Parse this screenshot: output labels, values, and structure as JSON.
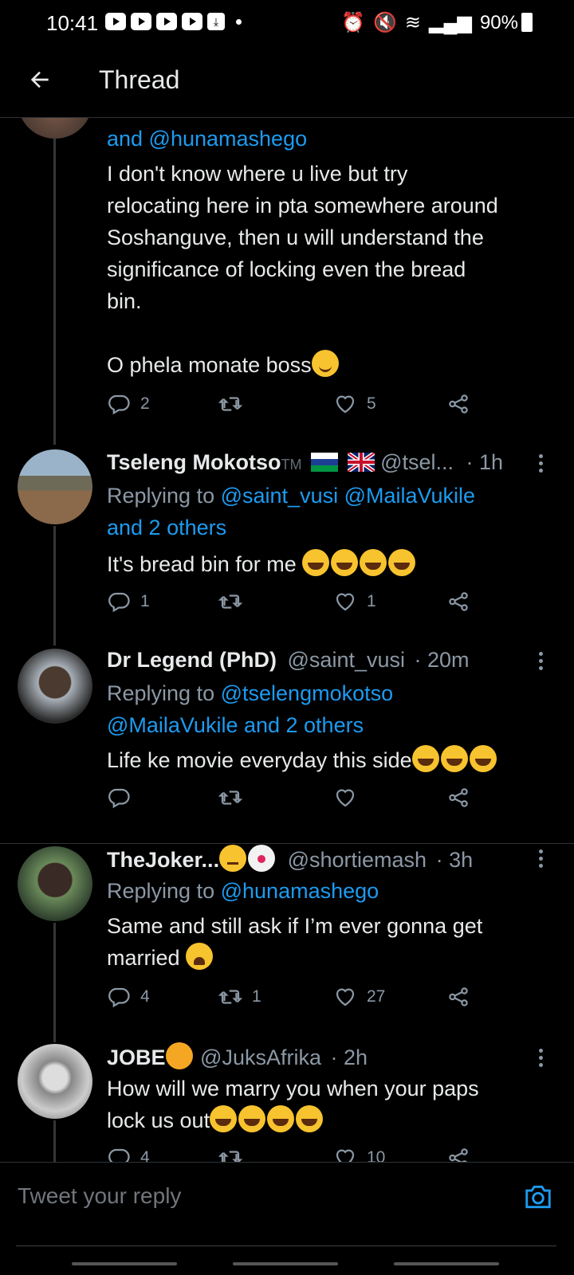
{
  "status_bar": {
    "time": "10:41",
    "battery": "90%"
  },
  "header": {
    "title": "Thread"
  },
  "tweets": [
    {
      "reply_mentions": "and @hunamashego",
      "text_lines": [
        "I don't know where u live but try",
        "relocating here in pta somewhere around",
        "Soshanguve, then u will understand the",
        "significance of locking even the bread",
        "bin."
      ],
      "text_extra": "O phela monate boss",
      "replies": "2",
      "retweets": "",
      "likes": "5"
    },
    {
      "name": "Tseleng Mokotso",
      "name_suffix": "TM",
      "handle": "@tsel...",
      "time": "· 1h",
      "replying_prefix": "Replying to",
      "replying_to": "@saint_vusi @MailaVukile",
      "replying_to_2": "and 2 others",
      "text": "It's bread bin for me ",
      "replies": "1",
      "retweets": "",
      "likes": "1"
    },
    {
      "name": "Dr Legend (PhD)",
      "handle": "@saint_vusi",
      "time": "· 20m",
      "replying_prefix": "Replying to",
      "replying_to": "@tselengmokotso",
      "replying_to_2": "@MailaVukile and 2 others",
      "text": "Life ke movie everyday this side",
      "replies": "",
      "retweets": "",
      "likes": ""
    },
    {
      "name": "TheJoker...",
      "handle": "@shortiemash",
      "time": "· 3h",
      "replying_prefix": "Replying to",
      "replying_to": "@hunamashego",
      "text_lines": [
        "Same  and still ask if I’m ever gonna get",
        "married "
      ],
      "replies": "4",
      "retweets": "1",
      "likes": "27"
    },
    {
      "name": "JOBE",
      "handle": "@JuksAfrika",
      "time": "· 2h",
      "text_lines": [
        "How will we marry you when your paps",
        "lock us out"
      ],
      "replies": "4",
      "retweets": "",
      "likes": "10"
    }
  ],
  "reply_bar": {
    "placeholder": "Tweet your reply"
  },
  "icons": {
    "back": "arrow-left-icon",
    "reply": "comment-icon",
    "retweet": "retweet-icon",
    "like": "heart-icon",
    "share": "share-icon",
    "camera": "camera-icon"
  },
  "colors": {
    "accent": "#1d9bf0",
    "background": "#000000",
    "muted": "#8b98a5"
  }
}
